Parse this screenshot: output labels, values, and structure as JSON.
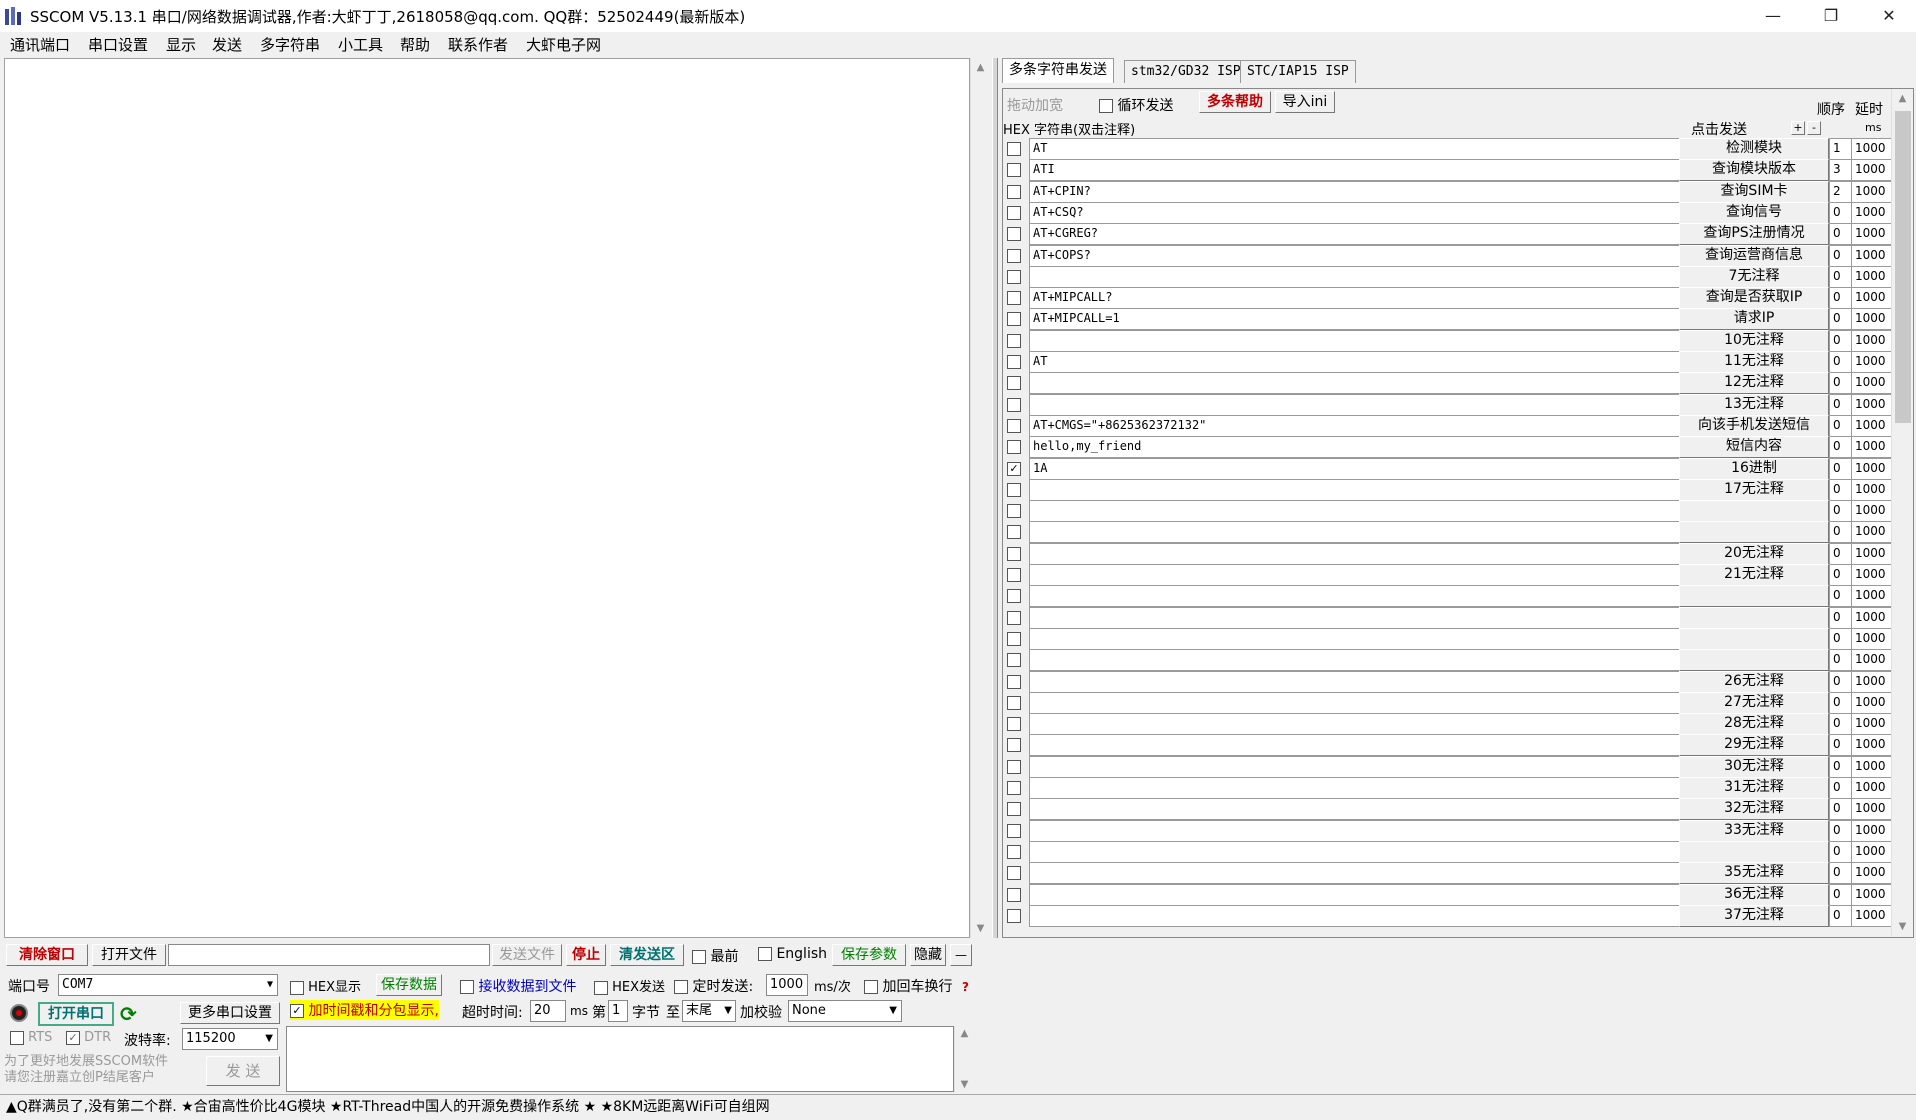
{
  "window": {
    "title": "SSCOM V5.13.1 串口/网络数据调试器,作者:大虾丁丁,2618058@qq.com. QQ群：52502449(最新版本)"
  },
  "menu": [
    "通讯端口",
    "串口设置",
    "显示",
    "发送",
    "多字符串",
    "小工具",
    "帮助",
    "联系作者",
    "大虾电子网"
  ],
  "tabs": [
    "多条字符串发送",
    "stm32/GD32 ISP",
    "STC/IAP15 ISP"
  ],
  "multi": {
    "drag_label": "拖动加宽",
    "loop_label": "循环发送",
    "help_label": "多条帮助",
    "import_label": "导入ini",
    "order_label": "顺序",
    "delay_label": "延时",
    "hex_header": "HEX 字符串(双击注释)",
    "click_send": "点击发送",
    "plus": "+",
    "minus": "-",
    "ms": "ms",
    "rows": [
      {
        "checked": false,
        "text": "AT",
        "btn": "检测模块",
        "order": "1",
        "delay": "1000"
      },
      {
        "checked": false,
        "text": "ATI",
        "btn": "查询模块版本",
        "order": "3",
        "delay": "1000"
      },
      {
        "checked": false,
        "text": "AT+CPIN?",
        "btn": "查询SIM卡",
        "order": "2",
        "delay": "1000"
      },
      {
        "checked": false,
        "text": "AT+CSQ?",
        "btn": "查询信号",
        "order": "0",
        "delay": "1000"
      },
      {
        "checked": false,
        "text": "AT+CGREG?",
        "btn": "查询PS注册情况",
        "order": "0",
        "delay": "1000"
      },
      {
        "checked": false,
        "text": "AT+COPS?",
        "btn": "查询运营商信息",
        "order": "0",
        "delay": "1000"
      },
      {
        "checked": false,
        "text": "",
        "btn": "7无注释",
        "order": "0",
        "delay": "1000"
      },
      {
        "checked": false,
        "text": "AT+MIPCALL?",
        "btn": "查询是否获取IP",
        "order": "0",
        "delay": "1000"
      },
      {
        "checked": false,
        "text": "AT+MIPCALL=1",
        "btn": "请求IP",
        "order": "0",
        "delay": "1000"
      },
      {
        "checked": false,
        "text": "",
        "btn": "10无注释",
        "order": "0",
        "delay": "1000"
      },
      {
        "checked": false,
        "text": "AT",
        "btn": "11无注释",
        "order": "0",
        "delay": "1000"
      },
      {
        "checked": false,
        "text": "",
        "btn": "12无注释",
        "order": "0",
        "delay": "1000"
      },
      {
        "checked": false,
        "text": "",
        "btn": "13无注释",
        "order": "0",
        "delay": "1000"
      },
      {
        "checked": false,
        "text": "AT+CMGS=\"+8625362372132\"",
        "btn": "向该手机发送短信",
        "order": "0",
        "delay": "1000"
      },
      {
        "checked": false,
        "text": "hello,my_friend",
        "btn": "短信内容",
        "order": "0",
        "delay": "1000"
      },
      {
        "checked": true,
        "text": "1A",
        "btn": "16进制",
        "order": "0",
        "delay": "1000"
      },
      {
        "checked": false,
        "text": "",
        "btn": "17无注释",
        "order": "0",
        "delay": "1000"
      },
      {
        "checked": false,
        "text": "",
        "btn": "",
        "order": "0",
        "delay": "1000"
      },
      {
        "checked": false,
        "text": "",
        "btn": "",
        "order": "0",
        "delay": "1000"
      },
      {
        "checked": false,
        "text": "",
        "btn": "20无注释",
        "order": "0",
        "delay": "1000"
      },
      {
        "checked": false,
        "text": "",
        "btn": "21无注释",
        "order": "0",
        "delay": "1000"
      },
      {
        "checked": false,
        "text": "",
        "btn": "",
        "order": "0",
        "delay": "1000"
      },
      {
        "checked": false,
        "text": "",
        "btn": "",
        "order": "0",
        "delay": "1000"
      },
      {
        "checked": false,
        "text": "",
        "btn": "",
        "order": "0",
        "delay": "1000"
      },
      {
        "checked": false,
        "text": "",
        "btn": "",
        "order": "0",
        "delay": "1000"
      },
      {
        "checked": false,
        "text": "",
        "btn": "26无注释",
        "order": "0",
        "delay": "1000"
      },
      {
        "checked": false,
        "text": "",
        "btn": "27无注释",
        "order": "0",
        "delay": "1000"
      },
      {
        "checked": false,
        "text": "",
        "btn": "28无注释",
        "order": "0",
        "delay": "1000"
      },
      {
        "checked": false,
        "text": "",
        "btn": "29无注释",
        "order": "0",
        "delay": "1000"
      },
      {
        "checked": false,
        "text": "",
        "btn": "30无注释",
        "order": "0",
        "delay": "1000"
      },
      {
        "checked": false,
        "text": "",
        "btn": "31无注释",
        "order": "0",
        "delay": "1000"
      },
      {
        "checked": false,
        "text": "",
        "btn": "32无注释",
        "order": "0",
        "delay": "1000"
      },
      {
        "checked": false,
        "text": "",
        "btn": "33无注释",
        "order": "0",
        "delay": "1000"
      },
      {
        "checked": false,
        "text": "",
        "btn": "",
        "order": "0",
        "delay": "1000"
      },
      {
        "checked": false,
        "text": "",
        "btn": "35无注释",
        "order": "0",
        "delay": "1000"
      },
      {
        "checked": false,
        "text": "",
        "btn": "36无注释",
        "order": "0",
        "delay": "1000"
      },
      {
        "checked": false,
        "text": "",
        "btn": "37无注释",
        "order": "0",
        "delay": "1000"
      }
    ]
  },
  "toolbar": {
    "clear": "清除窗口",
    "open_file": "打开文件",
    "send_file": "发送文件",
    "stop": "停止",
    "clear_send": "清发送区",
    "topmost": "最前",
    "english": "English",
    "save_params": "保存参数",
    "hide": "隐藏",
    "collapse": "—"
  },
  "serial": {
    "port_label": "端口号",
    "port_value": "COM7",
    "open_port": "打开串口",
    "more_settings": "更多串口设置",
    "rts": "RTS",
    "dtr": "DTR",
    "baud_label": "波特率:",
    "baud_value": "115200",
    "promo": "为了更好地发展SSCOM软件\n请您注册嘉立创P结尾客户",
    "send": "发 送"
  },
  "options": {
    "hex_display": "HEX显示",
    "save_data": "保存数据",
    "recv_to_file": "接收数据到文件",
    "hex_send": "HEX发送",
    "timed_send": "定时发送:",
    "timed_value": "1000",
    "ms_per": "ms/次",
    "add_crlf": "加回车换行",
    "timestamp": "加时间戳和分包显示,",
    "timeout_label": "超时时间:",
    "timeout_value": "20",
    "ms": "ms",
    "nth": "第",
    "nth_value": "1",
    "byte_label": "字节",
    "to_label": "至",
    "end_value": "末尾",
    "checksum_label": "加校验",
    "checksum_value": "None"
  },
  "status": "▲Q群满员了,没有第二个群. ★合宙高性价比4G模块 ★RT-Thread中国人的开源免费操作系统 ★ ★8KM远距离WiFi可自组网"
}
